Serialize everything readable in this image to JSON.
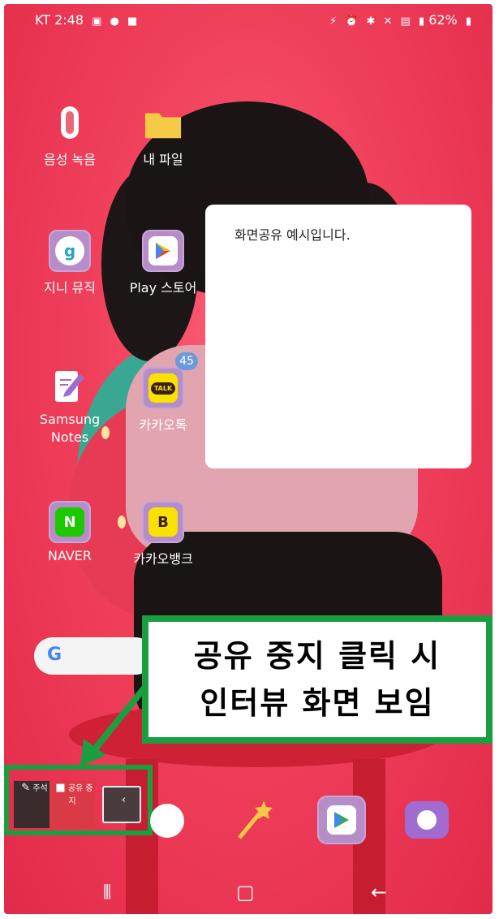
{
  "status_bar": {
    "carrier_time": "KT 2:48",
    "right_text": "62%",
    "icons": [
      "image-icon",
      "talk-icon",
      "video-icon",
      "nfc-icon",
      "alarm-icon",
      "bluetooth-icon",
      "mute-icon",
      "hd-icon",
      "lte-icon",
      "signal-icon",
      "battery-icon"
    ]
  },
  "apps": [
    {
      "label": "음성 녹음",
      "icon": "voice-recorder-icon"
    },
    {
      "label": "내 파일",
      "icon": "folder-icon"
    },
    {
      "label": "지니 뮤직",
      "icon": "genie-icon",
      "glyph": "g"
    },
    {
      "label": "Play 스토어",
      "icon": "play-store-icon"
    },
    {
      "label": "Samsung\nNotes",
      "icon": "notes-icon"
    },
    {
      "label": "카카오톡",
      "icon": "kakaotalk-icon",
      "glyph": "TALK",
      "badge": "45"
    },
    {
      "label": "NAVER",
      "icon": "naver-icon",
      "glyph": "N"
    },
    {
      "label": "카카오뱅크",
      "icon": "kakaobank-icon",
      "glyph": "B"
    }
  ],
  "memo": {
    "text": "화면공유 예시입니다."
  },
  "callout": {
    "line1": "공유 중지 클릭 시",
    "line2": "인터뷰 화면 보임"
  },
  "share_bar": {
    "annotate_label": "주석",
    "stop_label": "공유 중지"
  },
  "search": {
    "g": "G"
  },
  "colors": {
    "accent_green": "#1a9f40",
    "stop_red": "#d93a45"
  }
}
